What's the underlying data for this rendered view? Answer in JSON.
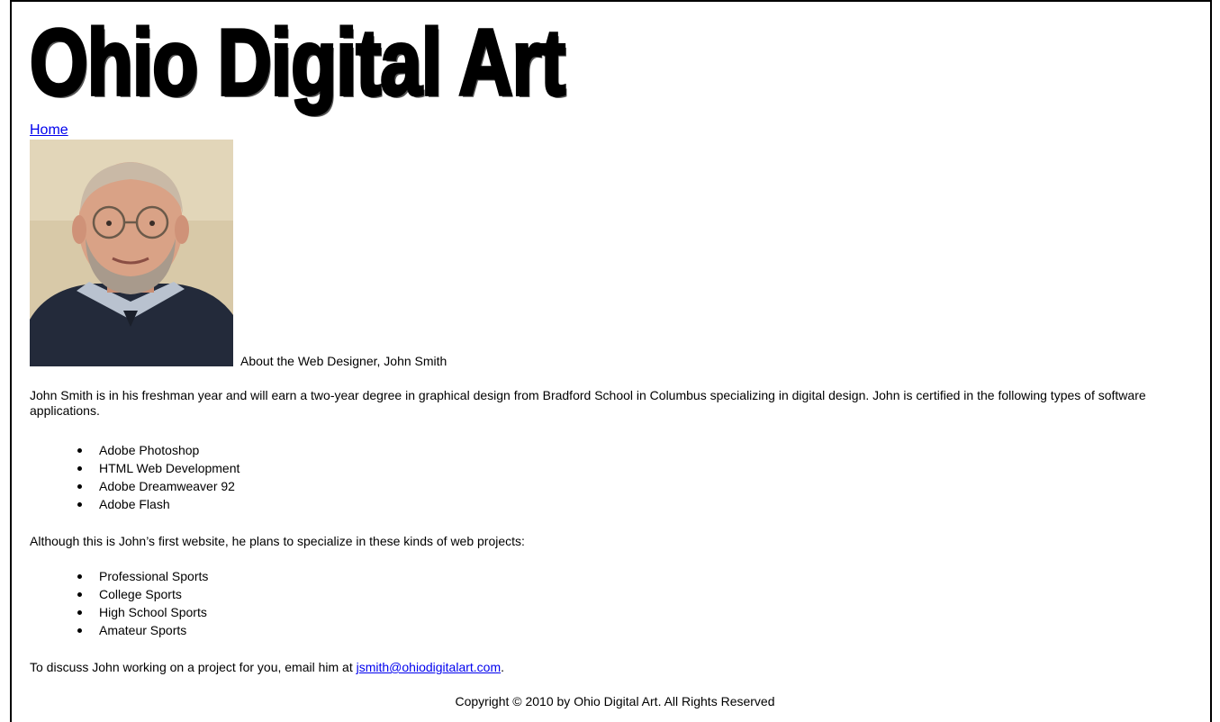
{
  "header": {
    "logo_text": "Ohio Digital Art"
  },
  "nav": {
    "home_label": "Home"
  },
  "profile": {
    "photo_alt": "John Smith portrait photo",
    "heading": "About the Web Designer, John Smith"
  },
  "intro": {
    "text": "John Smith is in his freshman year and will earn a two-year degree in graphical design from Bradford School in Columbus specializing in digital design.  John is certified in the following types of software applications."
  },
  "software": {
    "items": [
      "Adobe Photoshop",
      "HTML Web Development",
      "Adobe Dreamweaver 92",
      "Adobe Flash"
    ]
  },
  "plans": {
    "text": "Although this is John’s first website, he plans to specialize in these kinds of web projects:"
  },
  "projects": {
    "items": [
      "Professional Sports",
      "College Sports",
      "High School Sports",
      "Amateur Sports"
    ]
  },
  "contact": {
    "prefix": "To discuss John working on a project for you, email him at ",
    "email": "jsmith@ohiodigitalart.com",
    "suffix": "."
  },
  "footer": {
    "copyright": "Copyright © 2010 by Ohio Digital Art.  All Rights Reserved"
  },
  "colors": {
    "link": "#0000ee",
    "text": "#000000",
    "background": "#ffffff",
    "photo_background": "#d8c9a8",
    "sweater": "#232a3a",
    "skin": "#d9a286"
  }
}
